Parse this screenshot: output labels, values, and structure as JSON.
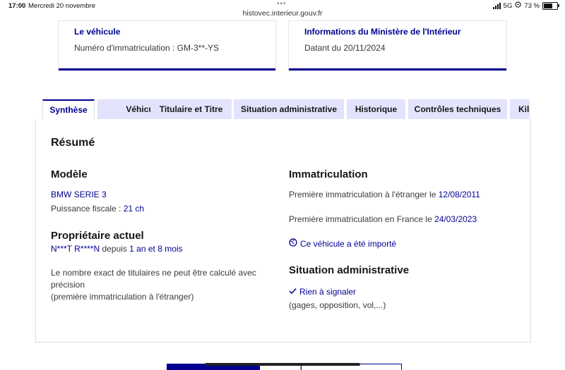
{
  "status_bar": {
    "time": "17:00",
    "date": "Mercredi 20 novembre",
    "network": "5G",
    "battery": "73 %",
    "battery_level": 0.73
  },
  "browser": {
    "url": "histovec.interieur.gouv.fr"
  },
  "cards": [
    {
      "title": "Le véhicule",
      "text": "Numéro d'immatriculation : GM-3**-YS"
    },
    {
      "title": "Informations du Ministère de l'Intérieur",
      "text": "Datant du 20/11/2024"
    }
  ],
  "tabs": [
    {
      "label": "Synthèse",
      "active": true
    },
    {
      "label": "Véhicule",
      "active": false
    },
    {
      "label": "Titulaire et Titre",
      "active": false
    },
    {
      "label": "Situation administrative",
      "active": false
    },
    {
      "label": "Historique",
      "active": false
    },
    {
      "label": "Contrôles techniques",
      "active": false
    },
    {
      "label": "Kilométrage",
      "active": false
    }
  ],
  "summary": {
    "title": "Résumé",
    "model": {
      "heading": "Modèle",
      "name": "BMW SERIE 3",
      "power_label": "Puissance fiscale : ",
      "power_value": "21 ch"
    },
    "owner": {
      "heading": "Propriétaire actuel",
      "name": "N***T R****N",
      "since_label": " depuis ",
      "since_value": "1 an et 8 mois",
      "note_line1": "Le nombre exact de titulaires ne peut être calculé avec",
      "note_line2": "précision",
      "note_line3": "(première immatriculation à l'étranger)"
    },
    "registration": {
      "heading": "Immatriculation",
      "foreign_label": "Première immatriculation à l'étranger le ",
      "foreign_date": "12/08/2011",
      "france_label": "Première immatriculation en France le ",
      "france_date": "24/03/2023",
      "imported_link": "Ce véhicule a été importé"
    },
    "admin": {
      "heading": "Situation administrative",
      "status": "Rien à signaler",
      "detail": "(gages, opposition, vol,...)"
    }
  },
  "colors": {
    "accent": "#000091",
    "tab_bg": "#e3e3fd"
  }
}
